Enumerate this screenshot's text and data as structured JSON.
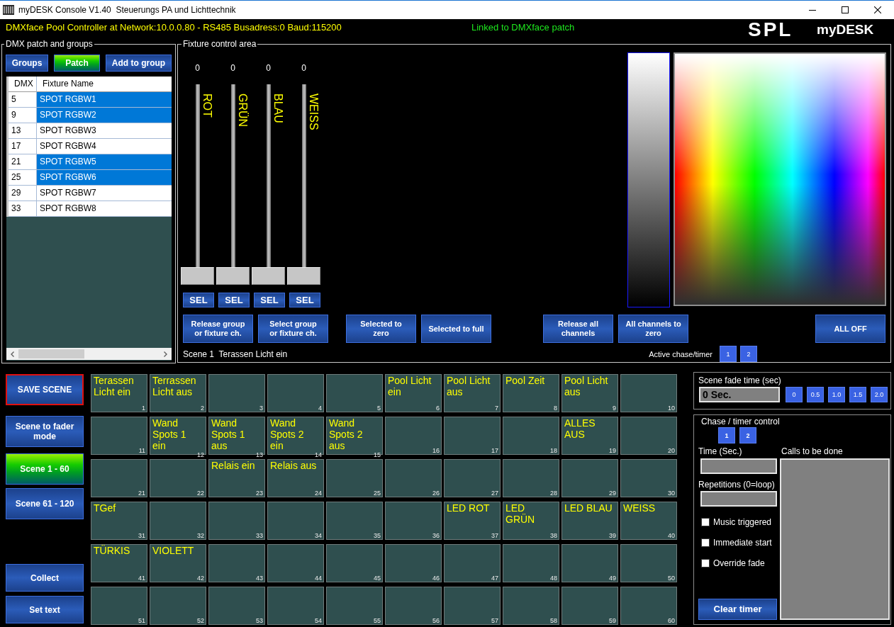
{
  "window": {
    "title": "myDESK Console V1.40  Steuerungs PA und Lichttechnik"
  },
  "header": {
    "connection": "DMXface Pool Controller at Network:10.0.0.80 - RS485 Busadress:0 Baud:115200",
    "link_status": "Linked to DMXface patch",
    "logo": "SPL",
    "app_name": "myDESK"
  },
  "patch_panel": {
    "title": "DMX patch and groups",
    "buttons": [
      {
        "label": "Groups",
        "selected": false
      },
      {
        "label": "Patch",
        "selected": true
      },
      {
        "label": "Add to group",
        "selected": false
      }
    ],
    "table": {
      "columns": [
        "DMX",
        "Fixture Name"
      ],
      "rows": [
        {
          "dmx": "5",
          "name": "SPOT RGBW1",
          "selected": true
        },
        {
          "dmx": "9",
          "name": "SPOT RGBW2",
          "selected": true
        },
        {
          "dmx": "13",
          "name": "SPOT RGBW3",
          "selected": false
        },
        {
          "dmx": "17",
          "name": "SPOT RGBW4",
          "selected": false
        },
        {
          "dmx": "21",
          "name": "SPOT RGBW5",
          "selected": true
        },
        {
          "dmx": "25",
          "name": "SPOT RGBW6",
          "selected": true
        },
        {
          "dmx": "29",
          "name": "SPOT RGBW7",
          "selected": false
        },
        {
          "dmx": "33",
          "name": "SPOT RGBW8",
          "selected": false
        }
      ]
    }
  },
  "fixture_panel": {
    "title": "Fixture control area",
    "faders": [
      {
        "value": "0",
        "name": "ROT",
        "level": 0,
        "select": "SEL"
      },
      {
        "value": "0",
        "name": "GRÜN",
        "level": 0,
        "select": "SEL"
      },
      {
        "value": "0",
        "name": "BLAU",
        "level": 0,
        "select": "SEL"
      },
      {
        "value": "0",
        "name": "WEISS",
        "level": 0,
        "select": "SEL"
      }
    ],
    "buttons": [
      "Release group\nor fixture ch.",
      "Select group\nor fixture ch.",
      "Selected to\nzero",
      "Selected to full",
      "Release all\nchannels",
      "All channels to\nzero",
      "ALL OFF"
    ],
    "scene_status": "Scene 1  Terassen Licht ein",
    "active_chase": {
      "label": "Active chase/timer",
      "buttons": [
        "1",
        "2"
      ]
    }
  },
  "scene_controls": {
    "save": "SAVE SCENE",
    "fader_mode": "Scene to fader\nmode",
    "pages": [
      {
        "label": "Scene 1 - 60",
        "selected": true
      },
      {
        "label": "Scene 61 - 120",
        "selected": false
      }
    ],
    "collect": "Collect",
    "set_text": "Set text"
  },
  "scenes": [
    {
      "number": "1",
      "label": "Terassen\nLicht ein"
    },
    {
      "number": "2",
      "label": "Terrassen\nLicht aus"
    },
    {
      "number": "3"
    },
    {
      "number": "4"
    },
    {
      "number": "5"
    },
    {
      "number": "6",
      "label": "Pool Licht\nein"
    },
    {
      "number": "7",
      "label": "Pool Licht\naus"
    },
    {
      "number": "8",
      "label": "Pool Zeit"
    },
    {
      "number": "9",
      "label": "Pool Licht\naus"
    },
    {
      "number": "10"
    },
    {
      "number": "11"
    },
    {
      "number": "12",
      "label": "Wand\nSpots 1\nein"
    },
    {
      "number": "13",
      "label": "Wand\nSpots 1\naus"
    },
    {
      "number": "14",
      "label": "Wand\nSpots 2\nein"
    },
    {
      "number": "15",
      "label": "Wand\nSpots 2\naus"
    },
    {
      "number": "16"
    },
    {
      "number": "17"
    },
    {
      "number": "18"
    },
    {
      "number": "19",
      "label": "ALLES\nAUS"
    },
    {
      "number": "20"
    },
    {
      "number": "21"
    },
    {
      "number": "22"
    },
    {
      "number": "23",
      "label": "Relais ein"
    },
    {
      "number": "24",
      "label": "Relais aus"
    },
    {
      "number": "25"
    },
    {
      "number": "26"
    },
    {
      "number": "27"
    },
    {
      "number": "28"
    },
    {
      "number": "29"
    },
    {
      "number": "30"
    },
    {
      "number": "31",
      "label": "TGef"
    },
    {
      "number": "32"
    },
    {
      "number": "33"
    },
    {
      "number": "34"
    },
    {
      "number": "35"
    },
    {
      "number": "36"
    },
    {
      "number": "37",
      "label": "LED ROT"
    },
    {
      "number": "38",
      "label": "LED\nGRÜN"
    },
    {
      "number": "39",
      "label": "LED BLAU"
    },
    {
      "number": "40",
      "label": "WEISS"
    },
    {
      "number": "41",
      "label": "TÜRKIS"
    },
    {
      "number": "42",
      "label": "VIOLETT"
    },
    {
      "number": "43"
    },
    {
      "number": "44"
    },
    {
      "number": "45"
    },
    {
      "number": "46"
    },
    {
      "number": "47"
    },
    {
      "number": "48"
    },
    {
      "number": "49"
    },
    {
      "number": "50"
    },
    {
      "number": "51"
    },
    {
      "number": "52"
    },
    {
      "number": "53"
    },
    {
      "number": "54"
    },
    {
      "number": "55"
    },
    {
      "number": "56"
    },
    {
      "number": "57"
    },
    {
      "number": "58"
    },
    {
      "number": "59"
    },
    {
      "number": "60"
    }
  ],
  "fade_time": {
    "title": "Scene fade time (sec)",
    "value": "0 Sec.",
    "presets": [
      "0",
      "0.5",
      "1.0",
      "1.5",
      "2.0"
    ]
  },
  "chase_control": {
    "title": "Chase / timer control",
    "timers": [
      "1",
      "2"
    ],
    "time_label": "Time (Sec.)",
    "repetitions_label": "Repetitions (0=loop)",
    "options": [
      {
        "label": "Music triggered",
        "checked": false
      },
      {
        "label": "Immediate start",
        "checked": false
      },
      {
        "label": "Override fade",
        "checked": false
      }
    ],
    "clear_button": "Clear timer",
    "calls_label": "Calls to be done"
  }
}
